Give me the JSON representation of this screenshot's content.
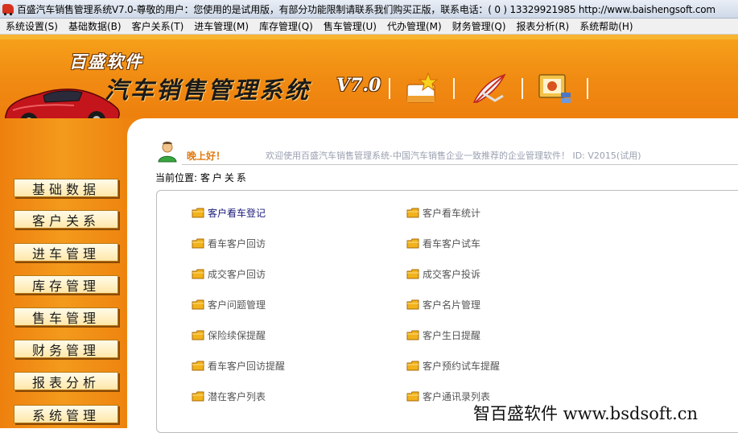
{
  "window": {
    "title": "百盛汽车销售管理系统V7.0-尊敬的用户：您使用的是试用版，有部分功能限制请联系我们购买正版，联系电话：( 0 ) 13329921985  http://www.baishengsoft.com"
  },
  "menu": [
    {
      "label": "系统设置(S)"
    },
    {
      "label": "基础数据(B)"
    },
    {
      "label": "客户关系(T)"
    },
    {
      "label": "进车管理(M)"
    },
    {
      "label": "库存管理(Q)"
    },
    {
      "label": "售车管理(U)"
    },
    {
      "label": "代办管理(M)"
    },
    {
      "label": "财务管理(Q)"
    },
    {
      "label": "报表分析(R)"
    },
    {
      "label": "系统帮助(H)"
    }
  ],
  "header": {
    "brand": "百盛软件",
    "system_title": "汽车销售管理系统",
    "version": "V7.0",
    "toolbar_icons": [
      "star-icon",
      "feather-icon",
      "presentation-icon"
    ]
  },
  "nav": [
    {
      "label": "基础数据"
    },
    {
      "label": "客户关系",
      "active": true
    },
    {
      "label": "进车管理"
    },
    {
      "label": "库存管理"
    },
    {
      "label": "售车管理"
    },
    {
      "label": "财务管理"
    },
    {
      "label": "报表分析"
    },
    {
      "label": "系统管理"
    }
  ],
  "content": {
    "greeting": "晚上好！",
    "welcome": "欢迎使用百盛汽车销售管理系统-中国汽车销售企业一致推荐的企业管理软件！ ID: V2015(试用)",
    "location_label": "当前位置:",
    "location_value": "客户关系",
    "links_left": [
      "客户看车登记",
      "看车客户回访",
      "成交客户回访",
      "客户问题管理",
      "保险续保提醒",
      "看车客户回访提醒",
      "潜在客户列表"
    ],
    "links_right": [
      "客户看车统计",
      "看车客户试车",
      "成交客户投诉",
      "客户名片管理",
      "客户生日提醒",
      "客户预约试车提醒",
      "客户通讯录列表"
    ]
  },
  "watermark": "智百盛软件 www.bsdsoft.cn",
  "colors": {
    "orange": "#ee840f",
    "nav_button": "#fff1c4",
    "link_icon": "#f2b21c"
  }
}
